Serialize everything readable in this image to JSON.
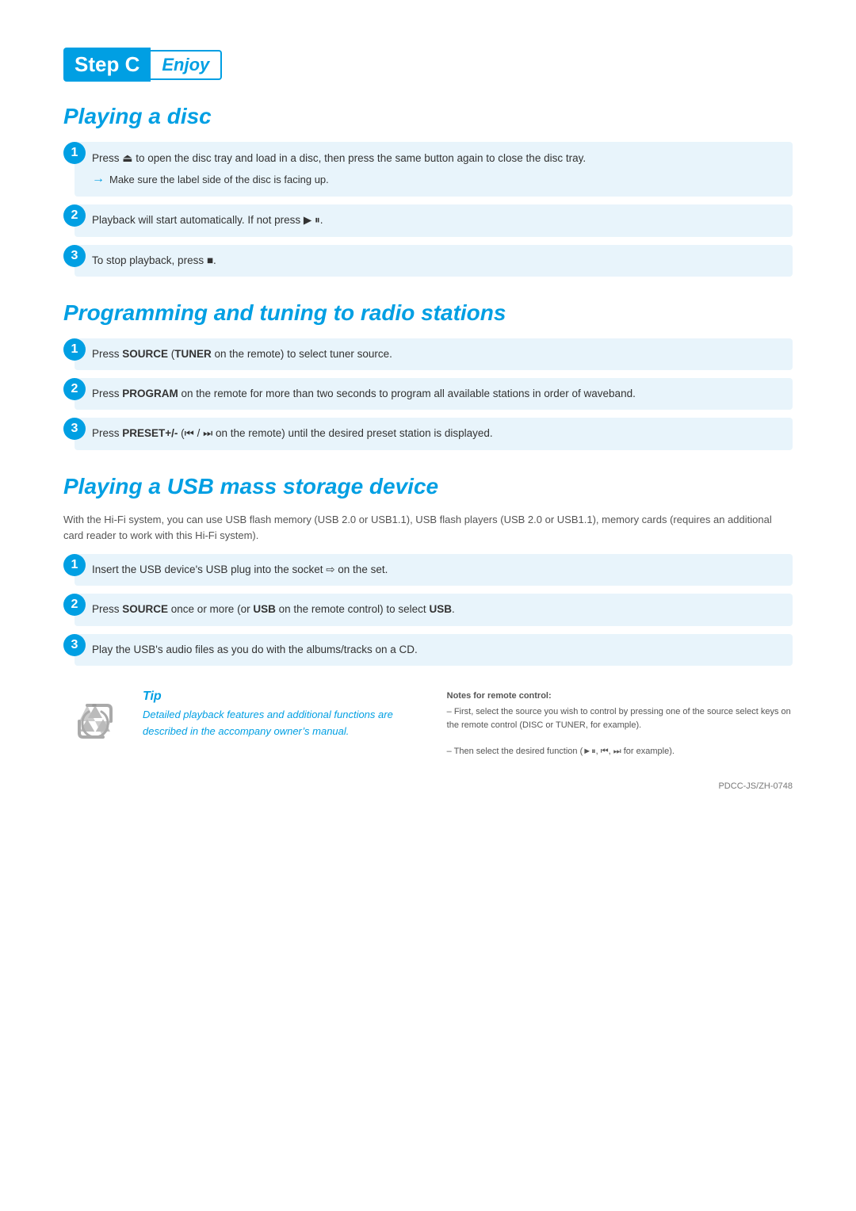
{
  "header": {
    "step_label": "Step C",
    "enjoy_label": "Enjoy"
  },
  "playing_disc": {
    "title": "Playing a disc",
    "steps": [
      {
        "id": 1,
        "main": "Press ⏏ to open the disc tray and load in a disc, then press the same button again to close the disc tray.",
        "sub": "Make sure the label side of the disc is facing up."
      },
      {
        "id": 2,
        "main": "Playback will start automatically. If not press ►⏸."
      },
      {
        "id": 3,
        "main": "To stop playback, press ■."
      }
    ]
  },
  "programming": {
    "title": "Programming and tuning to radio stations",
    "steps": [
      {
        "id": 1,
        "main": "Press SOURCE (TUNER on the remote) to select tuner source.",
        "bold_words": [
          "SOURCE",
          "TUNER"
        ]
      },
      {
        "id": 2,
        "main": "Press PROGRAM on the remote for more than two seconds to program all available stations in order of waveband.",
        "bold_words": [
          "PROGRAM"
        ]
      },
      {
        "id": 3,
        "main": "Press PRESET+/- (⏮ / ⏭ on the remote) until the desired preset station is displayed.",
        "bold_words": [
          "PRESET+/-"
        ]
      }
    ]
  },
  "usb": {
    "title": "Playing a USB mass storage device",
    "intro": "With the Hi-Fi system, you can use USB flash memory (USB 2.0 or USB1.1), USB flash players (USB 2.0 or USB1.1), memory cards (requires an additional card reader  to work with this Hi-Fi system).",
    "steps": [
      {
        "id": 1,
        "main": "Insert the USB device’s USB plug into the socket ⇨ on the set."
      },
      {
        "id": 2,
        "main": "Press SOURCE once or more (or USB on the remote control) to select USB.",
        "bold_words": [
          "SOURCE",
          "USB",
          "USB"
        ]
      },
      {
        "id": 3,
        "main": "Play the USB’s audio files as you do with the albums/tracks on a CD."
      }
    ]
  },
  "tip": {
    "title": "Tip",
    "text": "Detailed playback features and additional functions are described in the accompany owner’s manual.",
    "notes_title": "Notes for remote control:",
    "note1": "–  First, select the source you wish to control by pressing one of the source select keys on the remote control (DISC or TUNER, for example).",
    "note2": "–  Then select the desired function (►⏸, ⏮, ⏭ for example)."
  },
  "footer": {
    "code": "PDCC-JS/ZH-0748"
  }
}
